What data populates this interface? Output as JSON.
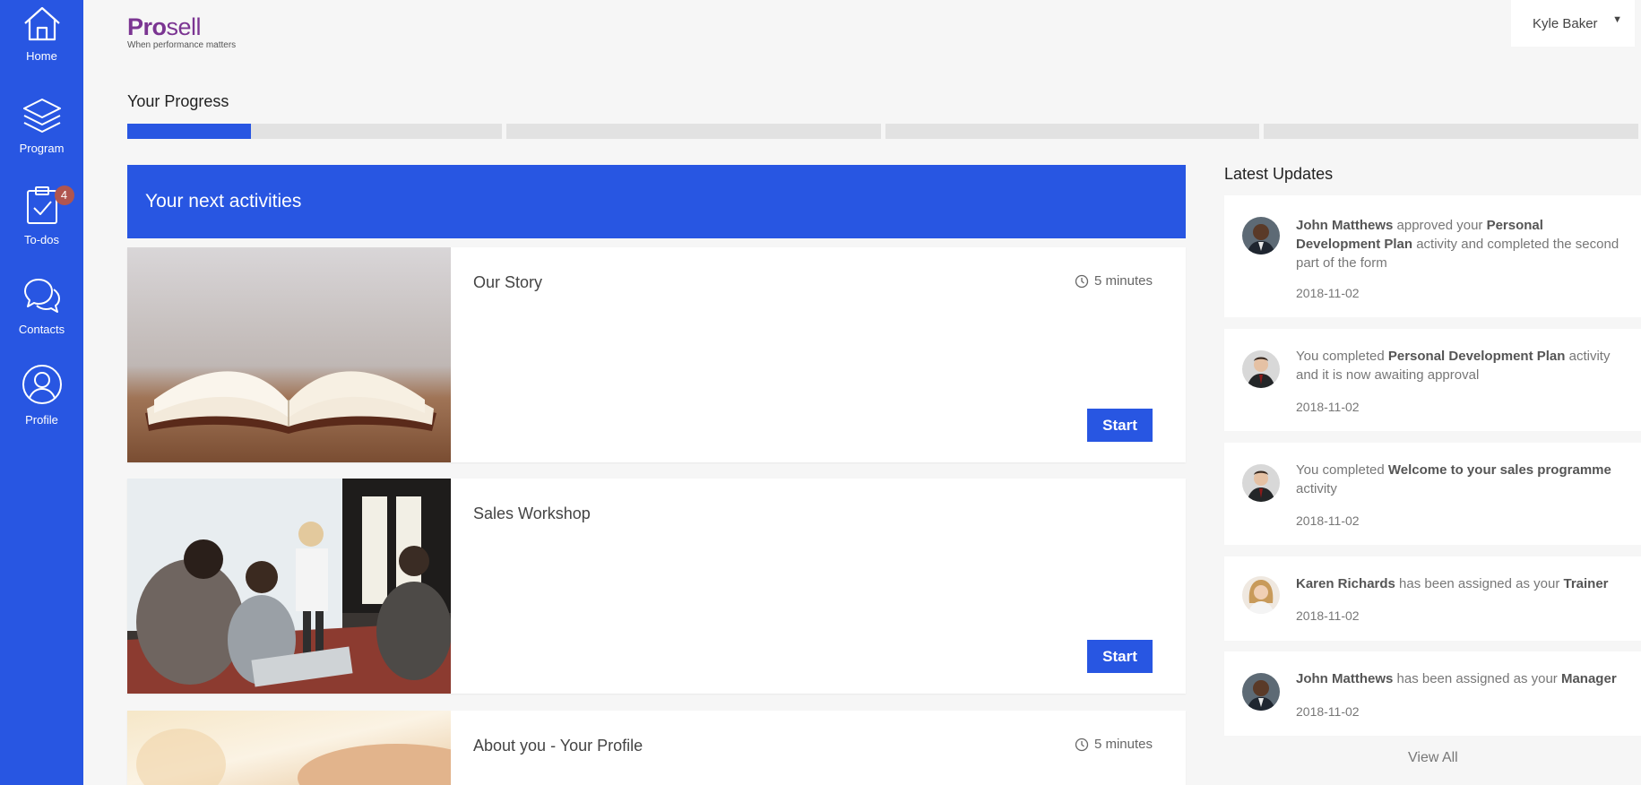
{
  "sidebar": {
    "items": [
      {
        "label": "Home",
        "icon": "home-icon"
      },
      {
        "label": "Program",
        "icon": "layers-icon"
      },
      {
        "label": "To-dos",
        "icon": "clipboard-check-icon",
        "badge": "4"
      },
      {
        "label": "Contacts",
        "icon": "chat-bubbles-icon"
      },
      {
        "label": "Profile",
        "icon": "user-circle-icon"
      }
    ]
  },
  "header": {
    "logo_pro": "Pro",
    "logo_sell": "sell",
    "logo_tagline": "When performance matters",
    "user_name": "Kyle Baker",
    "user_caret": "▼"
  },
  "progress": {
    "title": "Your Progress",
    "segments": 4,
    "first_segment_fill_fraction": 0.33
  },
  "activities": {
    "header": "Your next activities",
    "items": [
      {
        "title": "Our Story",
        "duration": "5 minutes",
        "button": "Start"
      },
      {
        "title": "Sales Workshop",
        "duration": "",
        "button": "Start"
      },
      {
        "title": "About you - Your Profile",
        "duration": "5 minutes",
        "button": ""
      }
    ]
  },
  "updates": {
    "title": "Latest Updates",
    "items": [
      {
        "actor": "John Matthews",
        "text1": " approved your ",
        "bold2": "Personal Development Plan",
        "text2": " activity and completed the second part of the form",
        "date": "2018-11-02"
      },
      {
        "actor": "",
        "text1": "You completed ",
        "bold2": "Personal Development Plan",
        "text2": " activity and it is now awaiting approval",
        "date": "2018-11-02"
      },
      {
        "actor": "",
        "text1": "You completed ",
        "bold2": "Welcome to your sales programme",
        "text2": " activity",
        "date": "2018-11-02"
      },
      {
        "actor": "Karen Richards",
        "text1": " has been assigned as your ",
        "bold2": "Trainer",
        "text2": "",
        "date": "2018-11-02"
      },
      {
        "actor": "John Matthews",
        "text1": " has been assigned as your ",
        "bold2": "Manager",
        "text2": "",
        "date": "2018-11-02"
      }
    ],
    "view_all": "View All"
  },
  "colors": {
    "brand_blue": "#2856e2",
    "logo_purple": "#7b3592",
    "badge_red": "#b0554f"
  }
}
